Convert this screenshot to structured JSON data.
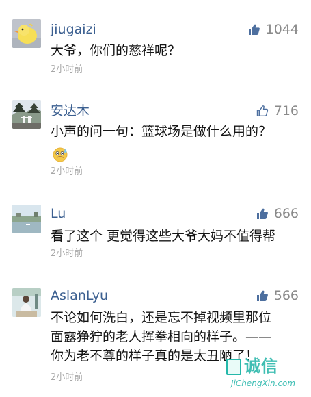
{
  "comments": [
    {
      "username": "jiugaizi",
      "likes": "1044",
      "text_lines": [
        "大爷，你们的慈祥呢？"
      ],
      "time": "2小时前",
      "avatar_icon": "duck-avatar",
      "liked": true
    },
    {
      "username": "安达木",
      "likes": "716",
      "text_lines": [
        "小声的问一句：篮球场是做什么用的？"
      ],
      "time": "2小时前",
      "avatar_icon": "landscape-avatar",
      "liked": false,
      "emoji": "sweat-emoji"
    },
    {
      "username": "Lu",
      "likes": "666",
      "text_lines": [
        "看了这个 更觉得这些大爷大妈不值得帮"
      ],
      "time": "2小时前",
      "avatar_icon": "lake-avatar",
      "liked": true
    },
    {
      "username": "AslanLyu",
      "likes": "566",
      "text_lines": [
        "不论如何洗白，还是忘不掉视频里那位",
        "面露狰狞的老人挥拳相向的样子。——",
        "你为老不尊的样子真的是太丑陋了！"
      ],
      "time": "2小时前",
      "avatar_icon": "person-avatar",
      "liked": true
    }
  ],
  "watermark": {
    "chars": "诚信",
    "domain": "JiChengXin.com"
  },
  "colors": {
    "username": "#3b5f90",
    "liked_thumb": "#4d6f9f",
    "unliked_thumb": "#4d6f9f",
    "time": "#a8a8a8",
    "watermark": "#25b8aa"
  }
}
